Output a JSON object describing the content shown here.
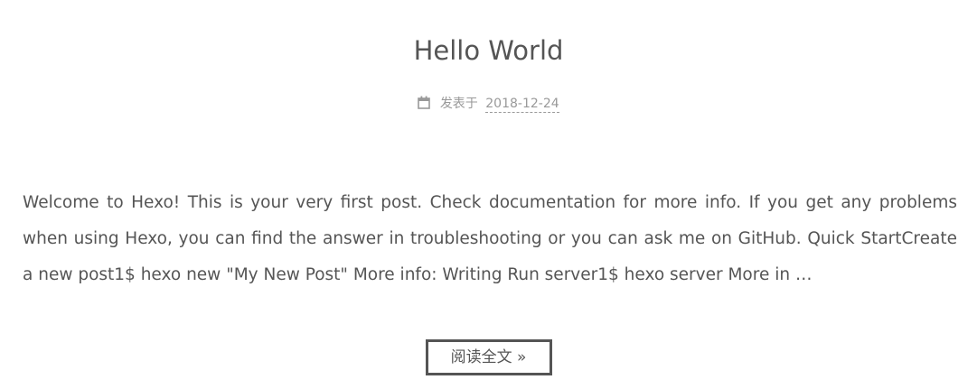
{
  "post": {
    "title": "Hello World",
    "meta": {
      "icon": "calendar-icon",
      "label": "发表于",
      "date": "2018-12-24"
    },
    "excerpt": "Welcome to Hexo! This is your very first post. Check documentation for more info. If you get any problems when using Hexo, you can find the answer in troubleshooting or you can ask me on GitHub. Quick StartCreate a new post1$ hexo new \"My New Post\" More info: Writing Run server1$ hexo server More in …",
    "read_more_label": "阅读全文 »"
  },
  "colors": {
    "text": "#555555",
    "meta": "#999999",
    "background": "#ffffff"
  }
}
